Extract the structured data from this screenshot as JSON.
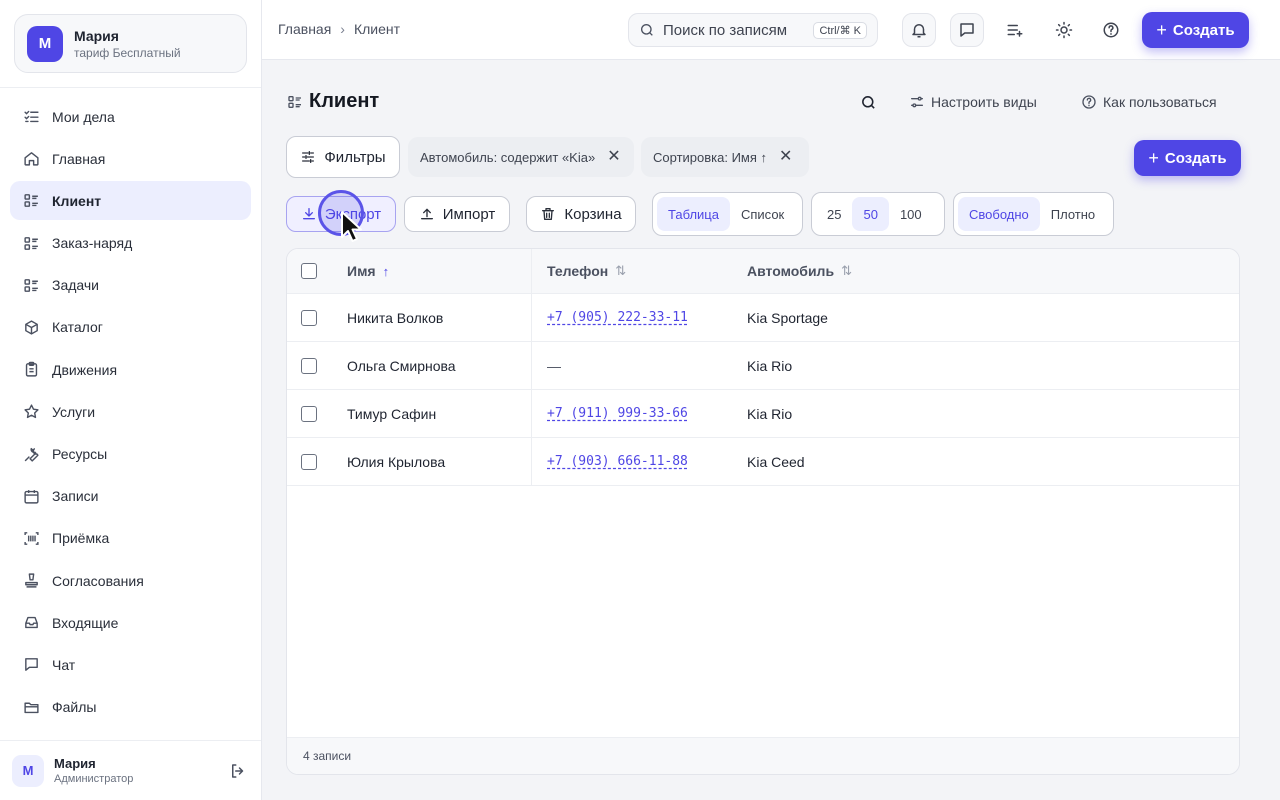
{
  "workspace": {
    "avatar": "М",
    "name": "Мария",
    "plan": "тариф Бесплатный"
  },
  "nav": [
    {
      "label": "Мои дела",
      "icon": "checklist-icon"
    },
    {
      "label": "Главная",
      "icon": "home-icon"
    },
    {
      "label": "Клиент",
      "icon": "list-icon",
      "active": true
    },
    {
      "label": "Заказ-наряд",
      "icon": "list-icon"
    },
    {
      "label": "Задачи",
      "icon": "list-icon"
    },
    {
      "label": "Каталог",
      "icon": "box-icon"
    },
    {
      "label": "Движения",
      "icon": "clipboard-icon"
    },
    {
      "label": "Услуги",
      "icon": "star-icon"
    },
    {
      "label": "Ресурсы",
      "icon": "wrench-icon"
    },
    {
      "label": "Записи",
      "icon": "calendar-icon"
    },
    {
      "label": "Приёмка",
      "icon": "barcode-icon"
    },
    {
      "label": "Согласования",
      "icon": "stamp-icon"
    },
    {
      "label": "Входящие",
      "icon": "inbox-icon"
    },
    {
      "label": "Чат",
      "icon": "chat-icon"
    },
    {
      "label": "Файлы",
      "icon": "folder-icon"
    }
  ],
  "user": {
    "avatar": "М",
    "name": "Мария",
    "role": "Администратор"
  },
  "topbar": {
    "breadcrumb": [
      "Главная",
      "Клиент"
    ],
    "search_placeholder": "Поиск по записям",
    "search_shortcut": "Ctrl/⌘ K",
    "create_label": "Создать"
  },
  "page": {
    "title": "Клиент",
    "configure_views": "Настроить виды",
    "how_to_use": "Как пользоваться",
    "create_label": "Создать"
  },
  "filters": {
    "button_label": "Фильтры",
    "tags": [
      "Автомобиль: содержит «Kia»",
      "Сортировка: Имя ↑"
    ]
  },
  "toolbar": {
    "export_label": "Экспорт",
    "import_label": "Импорт",
    "trash_label": "Корзина",
    "view_modes": [
      "Таблица",
      "Список"
    ],
    "view_selected": "Таблица",
    "page_sizes": [
      "25",
      "50",
      "100"
    ],
    "page_size_selected": "50",
    "densities": [
      "Свободно",
      "Плотно"
    ],
    "density_selected": "Свободно"
  },
  "table": {
    "columns": [
      "Имя",
      "Телефон",
      "Автомобиль"
    ],
    "rows": [
      {
        "name": "Никита Волков",
        "phone": "+7 (905) 222-33-11",
        "car": "Kia Sportage"
      },
      {
        "name": "Ольга Смирнова",
        "phone": "—",
        "car": "Kia Rio"
      },
      {
        "name": "Тимур Сафин",
        "phone": "+7 (911) 999-33-66",
        "car": "Kia Rio"
      },
      {
        "name": "Юлия Крылова",
        "phone": "+7 (903) 666-11-88",
        "car": "Kia Ceed"
      }
    ],
    "footer": "4 записи"
  },
  "colors": {
    "accent": "#4f46e5",
    "accent_soft": "#eceefe"
  }
}
